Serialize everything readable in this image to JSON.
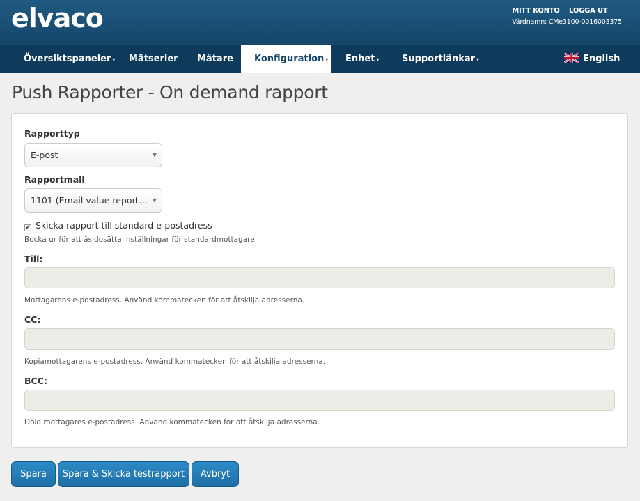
{
  "header": {
    "logo": "elvaco",
    "my_account": "MITT KONTO",
    "logout": "LOGGA UT",
    "hostname": "Värdnamn: CMe3100-0016003375"
  },
  "nav": {
    "items": [
      {
        "label": "Översiktspaneler",
        "caret": "▾"
      },
      {
        "label": "Mätserier",
        "caret": ""
      },
      {
        "label": "Mätare",
        "caret": ""
      },
      {
        "label": "Konfiguration",
        "caret": "▾"
      },
      {
        "label": "Enhet",
        "caret": "▾"
      },
      {
        "label": "Supportlänkar",
        "caret": "▾"
      }
    ],
    "language": "English"
  },
  "page": {
    "title": "Push Rapporter - On demand rapport"
  },
  "form": {
    "report_type_label": "Rapporttyp",
    "report_type_value": "E-post",
    "report_template_label": "Rapportmall",
    "report_template_value": "1101 (Email value report…",
    "send_default_label": "Skicka rapport till standard e-postadress",
    "send_default_checked": true,
    "send_default_help": "Bocka ur för att åsidosätta inställningar för standardmottagare.",
    "to_label": "Till:",
    "to_value": "",
    "to_help": "Mottagarens e-postadress. Använd kommatecken för att åtskilja adresserna.",
    "cc_label": "CC:",
    "cc_value": "",
    "cc_help": "Kopiamottagarens e-postadress. Använd kommatecken för att åtskilja adresserna.",
    "bcc_label": "BCC:",
    "bcc_value": "",
    "bcc_help": "Dold mottagares e-postadress. Använd kommatecken för att åtskilja adresserna."
  },
  "buttons": {
    "save": "Spara",
    "save_send_test": "Spara & Skicka testrapport",
    "cancel": "Avbryt"
  },
  "icons": {
    "select_arrow": "▼",
    "checkmark": "✔"
  },
  "colors": {
    "header_bg": "#1f5a82",
    "nav_bg": "#0e3a5c",
    "button_bg": "#2c8ac7"
  }
}
